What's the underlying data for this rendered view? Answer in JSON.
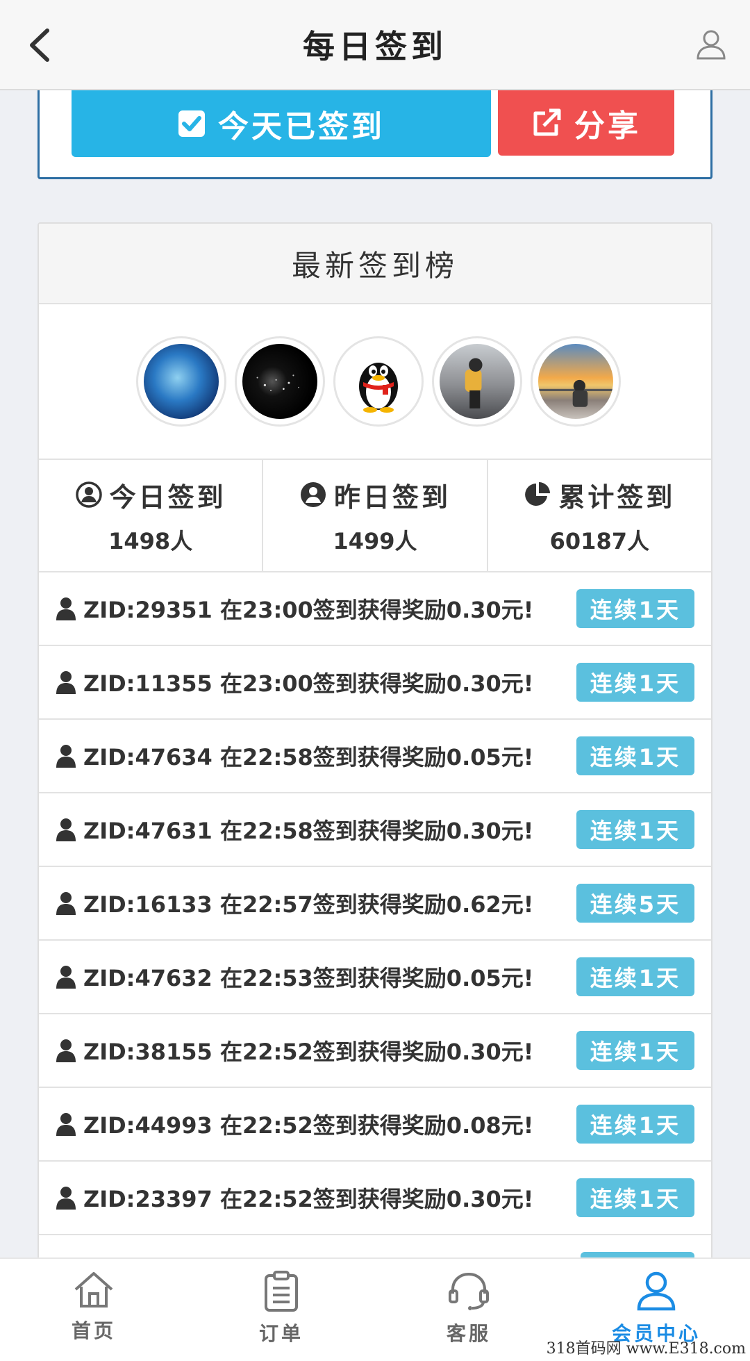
{
  "header": {
    "title": "每日签到"
  },
  "sign": {
    "signed_label": "今天已签到",
    "share_label": "分享"
  },
  "leaderboard": {
    "title": "最新签到榜",
    "stats": [
      {
        "label": "今日签到",
        "value": "1498人"
      },
      {
        "label": "昨日签到",
        "value": "1499人"
      },
      {
        "label": "累计签到",
        "value": "60187人"
      }
    ],
    "rows": [
      {
        "text": "ZID:29351 在23:00签到获得奖励0.30元!",
        "badge": "连续1天"
      },
      {
        "text": "ZID:11355 在23:00签到获得奖励0.30元!",
        "badge": "连续1天"
      },
      {
        "text": "ZID:47634 在22:58签到获得奖励0.05元!",
        "badge": "连续1天"
      },
      {
        "text": "ZID:47631 在22:58签到获得奖励0.30元!",
        "badge": "连续1天"
      },
      {
        "text": "ZID:16133 在22:57签到获得奖励0.62元!",
        "badge": "连续5天"
      },
      {
        "text": "ZID:47632 在22:53签到获得奖励0.05元!",
        "badge": "连续1天"
      },
      {
        "text": "ZID:38155 在22:52签到获得奖励0.30元!",
        "badge": "连续1天"
      },
      {
        "text": "ZID:44993 在22:52签到获得奖励0.08元!",
        "badge": "连续1天"
      },
      {
        "text": "ZID:23397 在22:52签到获得奖励0.30元!",
        "badge": "连续1天"
      },
      {
        "text": "",
        "badge": ""
      }
    ]
  },
  "tabs": [
    {
      "label": "首页",
      "icon": "home-icon",
      "active": false
    },
    {
      "label": "订单",
      "icon": "clipboard-icon",
      "active": false
    },
    {
      "label": "客服",
      "icon": "headset-icon",
      "active": false
    },
    {
      "label": "会员中心",
      "icon": "user-icon",
      "active": true
    }
  ],
  "watermark": "318首码网 www.E318.com",
  "colors": {
    "signed_button": "#27b4e6",
    "share_button": "#f05050",
    "badge": "#5bc0de",
    "active_tab": "#1b8ce4"
  }
}
